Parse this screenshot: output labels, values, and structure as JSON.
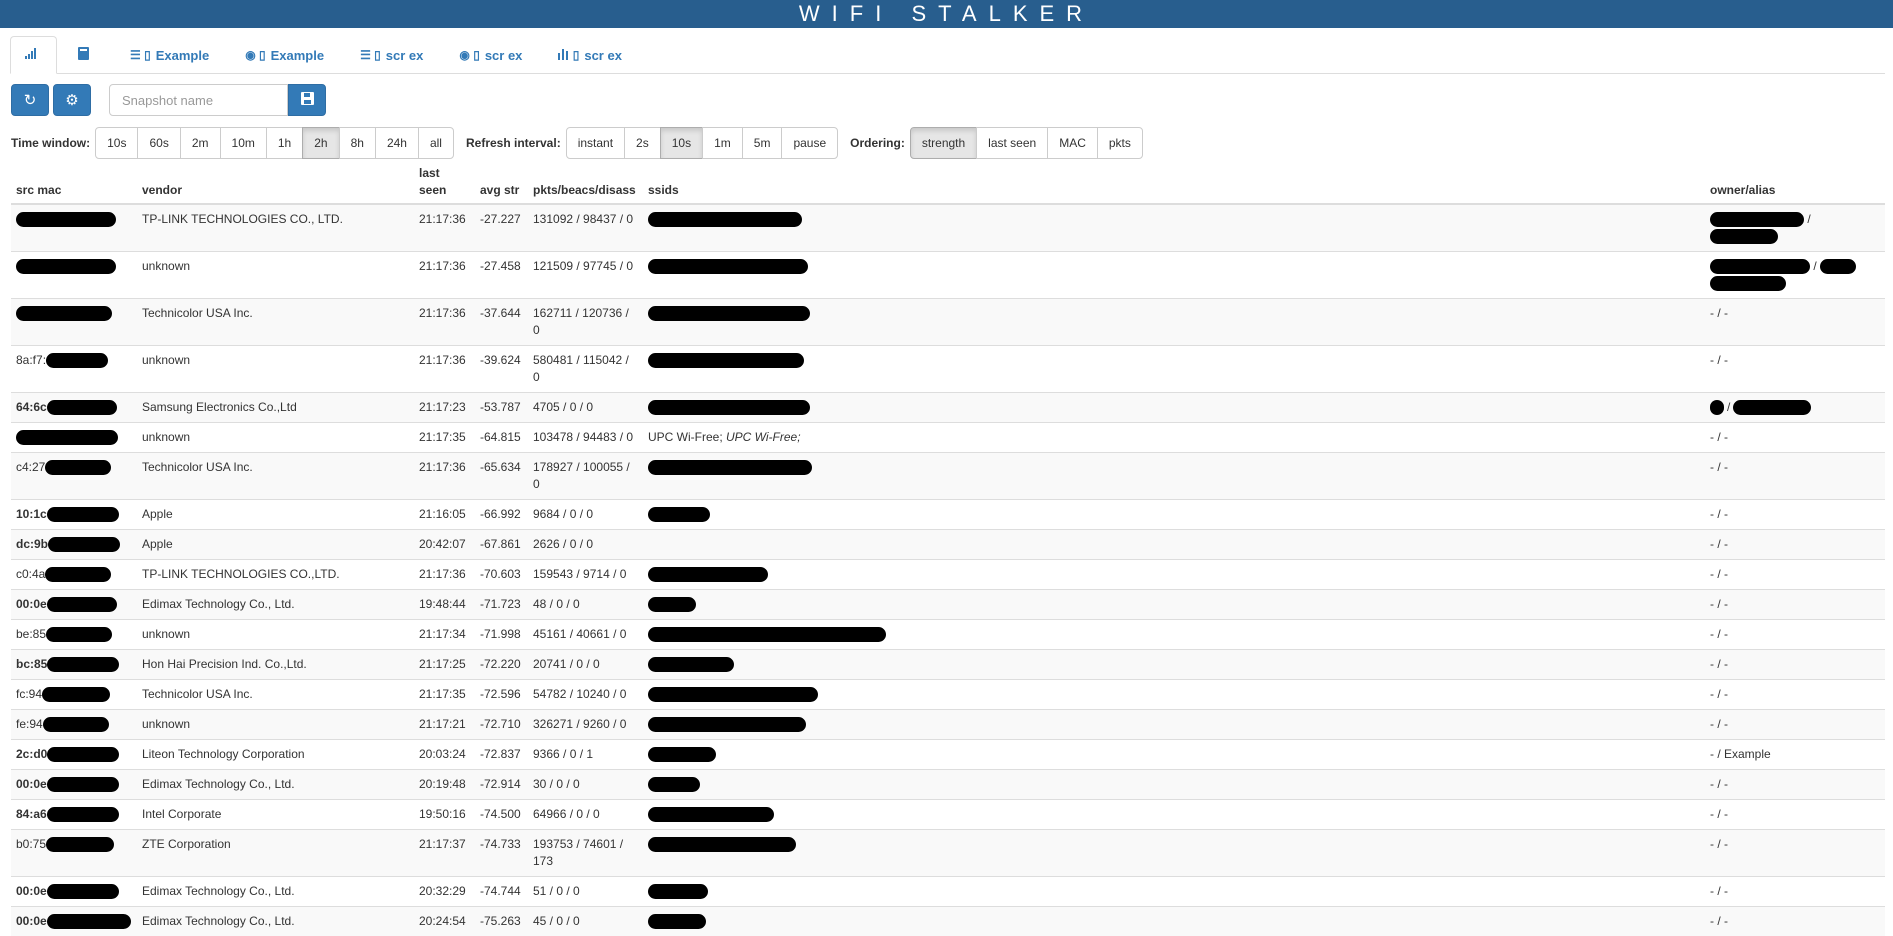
{
  "app": {
    "title": "WIFI STALKER"
  },
  "tabs": [
    {
      "icon": "signal-icon",
      "label": ""
    },
    {
      "icon": "book-icon",
      "label": ""
    },
    {
      "icon": "list-mobile-icon",
      "label": "Example"
    },
    {
      "icon": "eye-mobile-icon",
      "label": "Example"
    },
    {
      "icon": "list-mobile-icon",
      "label": "scr ex"
    },
    {
      "icon": "eye-mobile-icon",
      "label": "scr ex"
    },
    {
      "icon": "bars-mobile-icon",
      "label": "scr ex"
    }
  ],
  "toolbar": {
    "refresh_icon": "refresh-icon",
    "settings_icon": "gear-icon",
    "snapshot_placeholder": "Snapshot name",
    "save_icon": "save-icon"
  },
  "filters": {
    "time_window": {
      "label": "Time window:",
      "options": [
        "10s",
        "60s",
        "2m",
        "10m",
        "1h",
        "2h",
        "8h",
        "24h",
        "all"
      ],
      "selected": "2h"
    },
    "refresh_interval": {
      "label": "Refresh interval:",
      "options": [
        "instant",
        "2s",
        "10s",
        "1m",
        "5m",
        "pause"
      ],
      "selected": "10s"
    },
    "ordering": {
      "label": "Ordering:",
      "options": [
        "strength",
        "last seen",
        "MAC",
        "pkts"
      ],
      "selected": "strength"
    }
  },
  "table": {
    "headers": {
      "mac": "src mac",
      "vendor": "vendor",
      "last_seen": "last seen",
      "avg_str": "avg str",
      "pkts": "pkts/beacs/disass",
      "ssids": "ssids",
      "owner": "owner/alias"
    },
    "rows": [
      {
        "mac": "",
        "bold": false,
        "vendor": "TP-LINK TECHNOLOGIES CO., LTD.",
        "last_seen": "21:17:36",
        "avg_str": "-27.227",
        "pkts": "131092 / 98437 / 0",
        "ssids": "",
        "ssids_em": "",
        "owner": ""
      },
      {
        "mac": "",
        "bold": false,
        "vendor": "unknown",
        "last_seen": "21:17:36",
        "avg_str": "-27.458",
        "pkts": "121509 / 97745 / 0",
        "ssids": "",
        "ssids_em": "",
        "owner": ""
      },
      {
        "mac": "",
        "bold": false,
        "vendor": "Technicolor USA Inc.",
        "last_seen": "21:17:36",
        "avg_str": "-37.644",
        "pkts": "162711 / 120736 / 0",
        "ssids": "",
        "ssids_em": "",
        "owner": "- / -"
      },
      {
        "mac": "8a:f7:",
        "bold": false,
        "vendor": "unknown",
        "last_seen": "21:17:36",
        "avg_str": "-39.624",
        "pkts": "580481 / 115042 / 0",
        "ssids": "",
        "ssids_em": "",
        "owner": "- / -"
      },
      {
        "mac": "64:6c",
        "bold": true,
        "vendor": "Samsung Electronics Co.,Ltd",
        "last_seen": "21:17:23",
        "avg_str": "-53.787",
        "pkts": "4705 / 0 / 0",
        "ssids": "",
        "ssids_em": "",
        "owner": "/"
      },
      {
        "mac": "",
        "bold": false,
        "vendor": "unknown",
        "last_seen": "21:17:35",
        "avg_str": "-64.815",
        "pkts": "103478 / 94483 / 0",
        "ssids": "UPC Wi-Free; ",
        "ssids_em": "UPC Wi-Free;",
        "owner": "- / -"
      },
      {
        "mac": "c4:27",
        "bold": false,
        "vendor": "Technicolor USA Inc.",
        "last_seen": "21:17:36",
        "avg_str": "-65.634",
        "pkts": "178927 / 100055 / 0",
        "ssids": "",
        "ssids_em": "",
        "owner": "- / -"
      },
      {
        "mac": "10:1c",
        "bold": true,
        "vendor": "Apple",
        "last_seen": "21:16:05",
        "avg_str": "-66.992",
        "pkts": "9684 / 0 / 0",
        "ssids": "",
        "ssids_em": "",
        "owner": "- / -"
      },
      {
        "mac": "dc:9b",
        "bold": true,
        "vendor": "Apple",
        "last_seen": "20:42:07",
        "avg_str": "-67.861",
        "pkts": "2626 / 0 / 0",
        "ssids": "",
        "ssids_em": "",
        "owner": "- / -"
      },
      {
        "mac": "c0:4a",
        "bold": false,
        "vendor": "TP-LINK TECHNOLOGIES CO.,LTD.",
        "last_seen": "21:17:36",
        "avg_str": "-70.603",
        "pkts": "159543 / 9714 / 0",
        "ssids": "",
        "ssids_em": "",
        "owner": "- / -"
      },
      {
        "mac": "00:0e",
        "bold": true,
        "vendor": "Edimax Technology Co., Ltd.",
        "last_seen": "19:48:44",
        "avg_str": "-71.723",
        "pkts": "48 / 0 / 0",
        "ssids": "",
        "ssids_em": "",
        "owner": "- / -"
      },
      {
        "mac": "be:85",
        "bold": false,
        "vendor": "unknown",
        "last_seen": "21:17:34",
        "avg_str": "-71.998",
        "pkts": "45161 / 40661 / 0",
        "ssids": "",
        "ssids_em": "",
        "owner": "- / -"
      },
      {
        "mac": "bc:85",
        "bold": true,
        "vendor": "Hon Hai Precision Ind. Co.,Ltd.",
        "last_seen": "21:17:25",
        "avg_str": "-72.220",
        "pkts": "20741 / 0 / 0",
        "ssids": "",
        "ssids_em": "",
        "owner": "- / -"
      },
      {
        "mac": "fc:94",
        "bold": false,
        "vendor": "Technicolor USA Inc.",
        "last_seen": "21:17:35",
        "avg_str": "-72.596",
        "pkts": "54782 / 10240 / 0",
        "ssids": "",
        "ssids_em": "",
        "owner": "- / -"
      },
      {
        "mac": "fe:94",
        "bold": false,
        "vendor": "unknown",
        "last_seen": "21:17:21",
        "avg_str": "-72.710",
        "pkts": "326271 / 9260 / 0",
        "ssids": "",
        "ssids_em": "",
        "owner": "- / -"
      },
      {
        "mac": "2c:d0",
        "bold": true,
        "vendor": "Liteon Technology Corporation",
        "last_seen": "20:03:24",
        "avg_str": "-72.837",
        "pkts": "9366 / 0 / 1",
        "ssids": "",
        "ssids_em": "",
        "owner": "- / Example"
      },
      {
        "mac": "00:0e",
        "bold": true,
        "vendor": "Edimax Technology Co., Ltd.",
        "last_seen": "20:19:48",
        "avg_str": "-72.914",
        "pkts": "30 / 0 / 0",
        "ssids": "",
        "ssids_em": "",
        "owner": "- / -"
      },
      {
        "mac": "84:a6",
        "bold": true,
        "vendor": "Intel Corporate",
        "last_seen": "19:50:16",
        "avg_str": "-74.500",
        "pkts": "64966 / 0 / 0",
        "ssids": "",
        "ssids_em": "",
        "owner": "- / -"
      },
      {
        "mac": "b0:75",
        "bold": false,
        "vendor": "ZTE Corporation",
        "last_seen": "21:17:37",
        "avg_str": "-74.733",
        "pkts": "193753 / 74601 / 173",
        "ssids": "",
        "ssids_em": "",
        "owner": "- / -"
      },
      {
        "mac": "00:0e",
        "bold": true,
        "vendor": "Edimax Technology Co., Ltd.",
        "last_seen": "20:32:29",
        "avg_str": "-74.744",
        "pkts": "51 / 0 / 0",
        "ssids": "",
        "ssids_em": "",
        "owner": "- / -"
      },
      {
        "mac": "00:0e",
        "bold": true,
        "vendor": "Edimax Technology Co., Ltd.",
        "last_seen": "20:24:54",
        "avg_str": "-75.263",
        "pkts": "45 / 0 / 0",
        "ssids": "",
        "ssids_em": "",
        "owner": "- / -"
      }
    ]
  },
  "colors": {
    "header_bg": "#285e8e",
    "accent": "#337ab7",
    "redaction": "#000000"
  }
}
